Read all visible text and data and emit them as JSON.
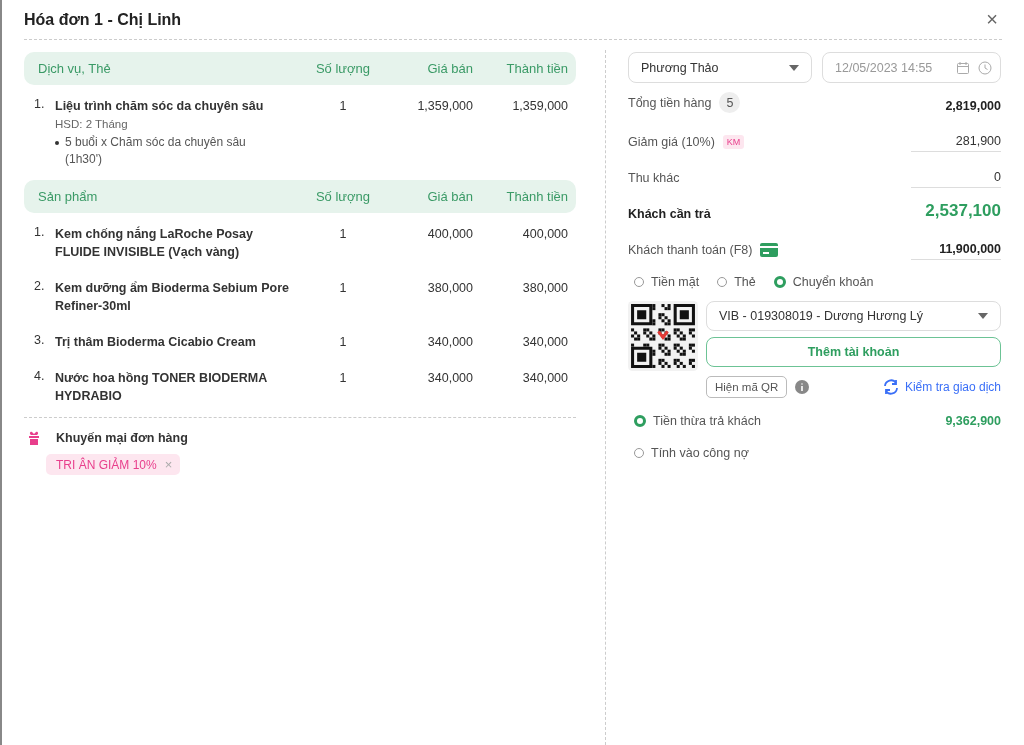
{
  "window": {
    "title": "Hóa đơn 1 - Chị Linh",
    "close": "×"
  },
  "sections": [
    {
      "columns": [
        "Dịch vụ, Thẻ",
        "Số lượng",
        "Giá bán",
        "Thành tiền"
      ],
      "items": [
        {
          "index": "1.",
          "name": "Liệu trình chăm sóc da chuyên sâu",
          "expiry": "HSD: 2 Tháng",
          "details": [
            "5 buổi x Chăm sóc da chuyên sâu (1h30')"
          ],
          "qty": "1",
          "price": "1,359,000",
          "total": "1,359,000"
        }
      ]
    },
    {
      "columns": [
        "Sản phẩm",
        "Số lượng",
        "Giá bán",
        "Thành tiền"
      ],
      "items": [
        {
          "index": "1.",
          "name": "Kem chống nắng LaRoche Posay FLUIDE INVISIBLE (Vạch vàng)",
          "qty": "1",
          "price": "400,000",
          "total": "400,000"
        },
        {
          "index": "2.",
          "name": "Kem dưỡng ẩm Bioderma Sebium Pore Refiner-30ml",
          "qty": "1",
          "price": "380,000",
          "total": "380,000"
        },
        {
          "index": "3.",
          "name": "Trị thâm Bioderma Cicabio Cream",
          "qty": "1",
          "price": "340,000",
          "total": "340,000"
        },
        {
          "index": "4.",
          "name": "Nước hoa hồng TONER BIODERMA HYDRABIO",
          "qty": "1",
          "price": "340,000",
          "total": "340,000"
        }
      ]
    }
  ],
  "promotion": {
    "title": "Khuyến mại đơn hàng",
    "tags": [
      "TRI ÂN GIẢM 10%"
    ],
    "remove": "×"
  },
  "staff_select": {
    "value": "Phương Thảo"
  },
  "date_field": {
    "value": "12/05/2023 14:55"
  },
  "summary": [
    {
      "kind": "total",
      "label": "Tổng tiền hàng",
      "badge": "5",
      "value": "2,819,000"
    },
    {
      "kind": "discount",
      "label": "Giảm giá (10%)",
      "badge": "KM",
      "value": "281,900"
    },
    {
      "kind": "input",
      "label": "Thu khác",
      "value": "0"
    },
    {
      "kind": "due",
      "label": "Khách cần trả",
      "value": "2,537,100"
    },
    {
      "kind": "paid",
      "label": "Khách thanh toán (F8)",
      "value": "11,900,000"
    }
  ],
  "payment_methods": [
    {
      "label": "Tiền mặt",
      "selected": false
    },
    {
      "label": "Thẻ",
      "selected": false
    },
    {
      "label": "Chuyển khoản",
      "selected": true
    }
  ],
  "bank_select": {
    "value": "VIB - 019308019 - Dương Hương Lý"
  },
  "add_account_button": "Thêm tài khoản",
  "show_qr_button": "Hiện mã QR",
  "check_transaction_link": "Kiểm tra giao dịch",
  "change_options": [
    {
      "label": "Tiền thừa trả khách",
      "value": "9,362,900",
      "selected": true
    },
    {
      "label": "Tính vào công nợ",
      "selected": false
    }
  ]
}
